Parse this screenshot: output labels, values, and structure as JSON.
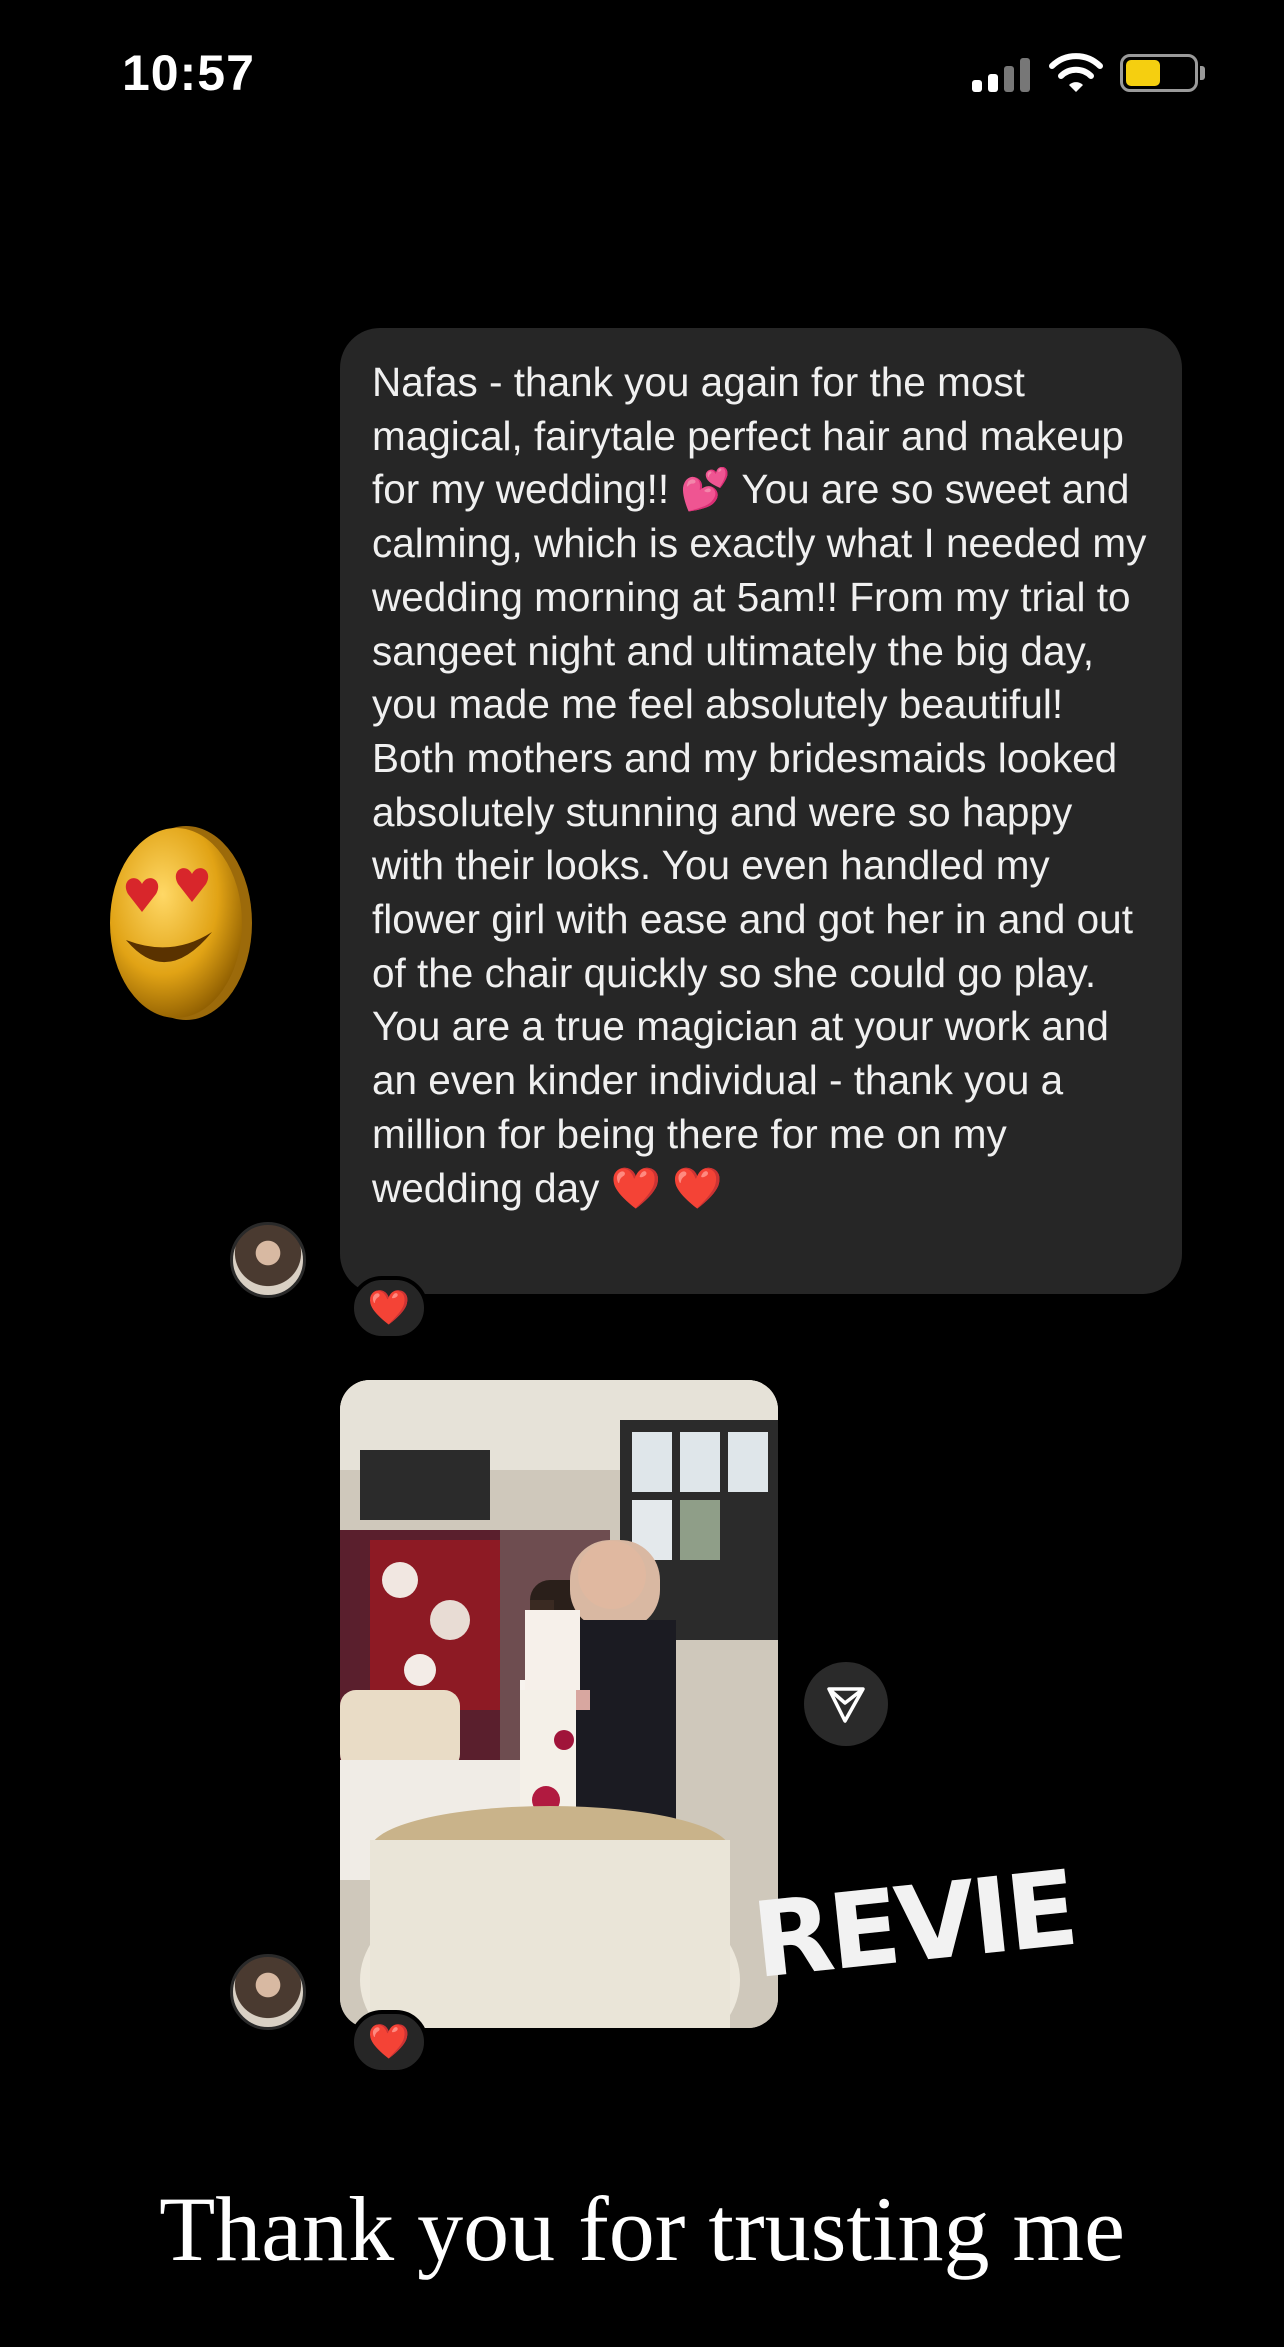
{
  "status_bar": {
    "time": "10:57",
    "battery_color": "#f5cf10"
  },
  "message": {
    "text": "Nafas - thank you again for the most magical, fairytale perfect hair and makeup for my wedding!! 💕 You are so sweet and calming, which is exactly what I needed my wedding morning at 5am!! From my trial to sangeet night and ultimately the big day, you made me feel absolutely beautiful! Both mothers and my bridesmaids looked absolutely stunning and were so happy with their looks. You even handled my flower girl with ease and got her in and out of the chair quickly so she could go play. You are a true magician at your work and an even kinder individual - thank you a million for being there for me on my wedding day ❤️ ❤️",
    "reaction": "❤️"
  },
  "photo_message": {
    "reaction": "❤️",
    "icon": "send-icon"
  },
  "stickers": {
    "emoji": "heart-eyes-emoji",
    "review_text": "REVIE"
  },
  "caption": "Thank you for trusting me"
}
